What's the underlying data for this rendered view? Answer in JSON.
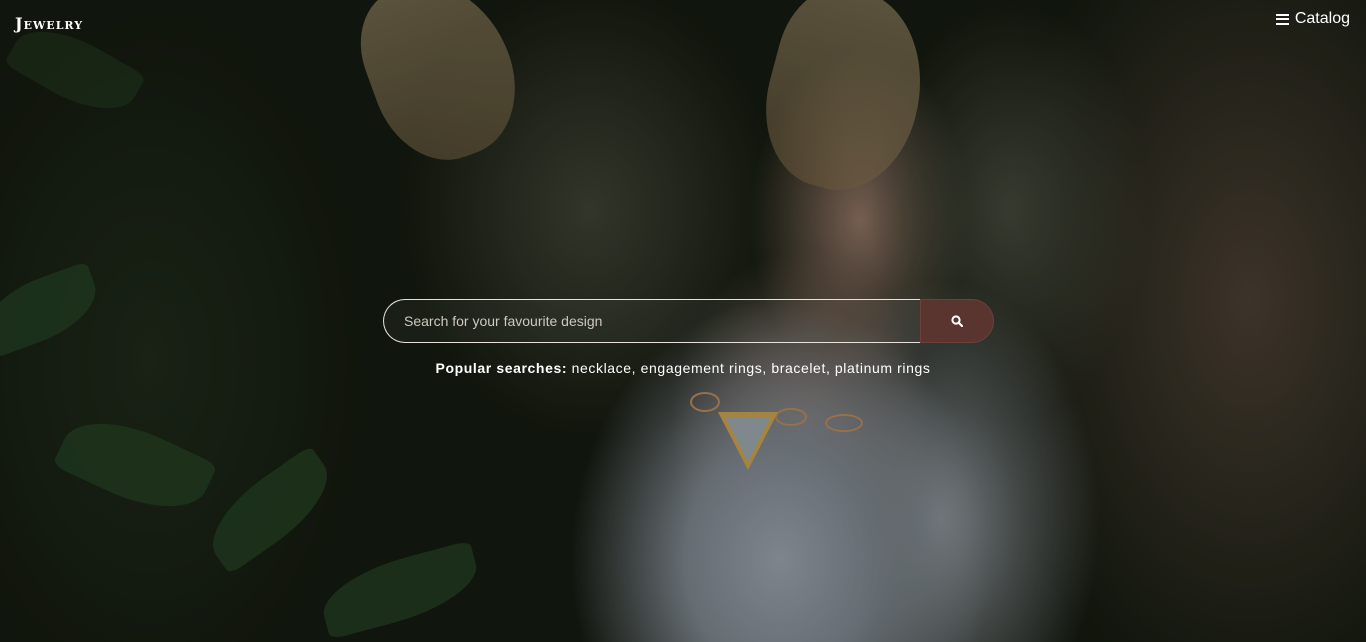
{
  "header": {
    "logo_text": "Jewelry",
    "catalog_label": "Catalog",
    "menu_icon": "hamburger-icon"
  },
  "search": {
    "placeholder": "Search for your favourite design",
    "value": "",
    "button_icon": "search-icon"
  },
  "popular": {
    "label": "Popular searches:",
    "terms": [
      "necklace",
      "engagement rings",
      "bracelet",
      "platinum rings"
    ]
  },
  "colors": {
    "search_button": "#5a3530",
    "text": "#ffffff",
    "input_border": "#e8e2dc"
  }
}
